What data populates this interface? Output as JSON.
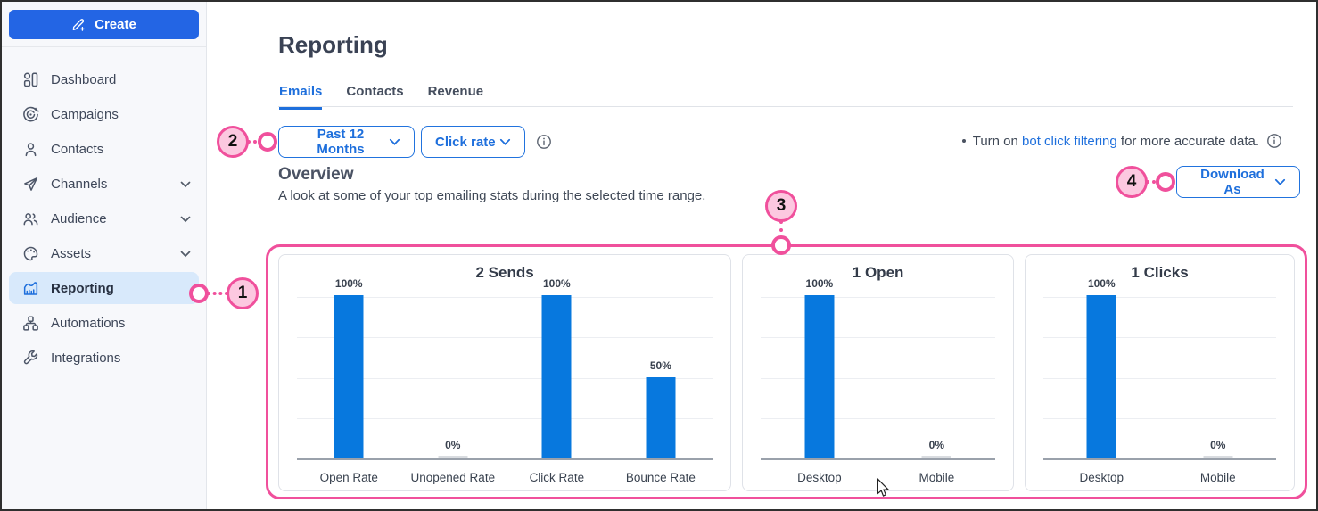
{
  "sidebar": {
    "create_label": "Create",
    "items": [
      {
        "label": "Dashboard",
        "icon": "dashboard-icon",
        "expandable": false,
        "active": false
      },
      {
        "label": "Campaigns",
        "icon": "campaigns-icon",
        "expandable": false,
        "active": false
      },
      {
        "label": "Contacts",
        "icon": "contacts-icon",
        "expandable": false,
        "active": false
      },
      {
        "label": "Channels",
        "icon": "channels-icon",
        "expandable": true,
        "active": false
      },
      {
        "label": "Audience",
        "icon": "audience-icon",
        "expandable": true,
        "active": false
      },
      {
        "label": "Assets",
        "icon": "assets-icon",
        "expandable": true,
        "active": false
      },
      {
        "label": "Reporting",
        "icon": "reporting-icon",
        "expandable": false,
        "active": true
      },
      {
        "label": "Automations",
        "icon": "automations-icon",
        "expandable": false,
        "active": false
      },
      {
        "label": "Integrations",
        "icon": "integrations-icon",
        "expandable": false,
        "active": false
      }
    ]
  },
  "header": {
    "title": "Reporting",
    "tabs": [
      {
        "label": "Emails",
        "active": true
      },
      {
        "label": "Contacts",
        "active": false
      },
      {
        "label": "Revenue",
        "active": false
      }
    ]
  },
  "filters": {
    "date_range": "Past 12 Months",
    "metric": "Click rate"
  },
  "notice": {
    "prefix": "Turn on ",
    "link_text": "bot click filtering",
    "suffix": " for more accurate data."
  },
  "overview": {
    "heading": "Overview",
    "description": "A look at some of your top emailing stats during the selected time range.",
    "download_label": "Download As"
  },
  "annotations": [
    {
      "number": "1",
      "target": "reporting-nav-item"
    },
    {
      "number": "2",
      "target": "date-range-dropdown"
    },
    {
      "number": "3",
      "target": "overview-charts-area"
    },
    {
      "number": "4",
      "target": "download-as-dropdown"
    }
  ],
  "colors": {
    "accent_blue": "#1e6fdc",
    "bar_blue": "#0778de",
    "create_button_blue": "#2365e4",
    "annotation_pink": "#f0509c",
    "annotation_pink_fill": "#fcc8e0",
    "active_item_bg": "#d8e9fb",
    "sidebar_bg": "#f7f8fb"
  },
  "chart_data": [
    {
      "type": "bar",
      "title": "2 Sends",
      "categories": [
        "Open Rate",
        "Unopened Rate",
        "Click Rate",
        "Bounce Rate"
      ],
      "values": [
        100,
        0,
        100,
        50
      ],
      "value_labels": [
        "100%",
        "0%",
        "100%",
        "50%"
      ],
      "ylim": [
        0,
        100
      ],
      "grid": true,
      "bar_color": "#0778de"
    },
    {
      "type": "bar",
      "title": "1 Open",
      "categories": [
        "Desktop",
        "Mobile"
      ],
      "values": [
        100,
        0
      ],
      "value_labels": [
        "100%",
        "0%"
      ],
      "ylim": [
        0,
        100
      ],
      "grid": true,
      "bar_color": "#0778de"
    },
    {
      "type": "bar",
      "title": "1 Clicks",
      "categories": [
        "Desktop",
        "Mobile"
      ],
      "values": [
        100,
        0
      ],
      "value_labels": [
        "100%",
        "0%"
      ],
      "ylim": [
        0,
        100
      ],
      "grid": true,
      "bar_color": "#0778de"
    }
  ]
}
